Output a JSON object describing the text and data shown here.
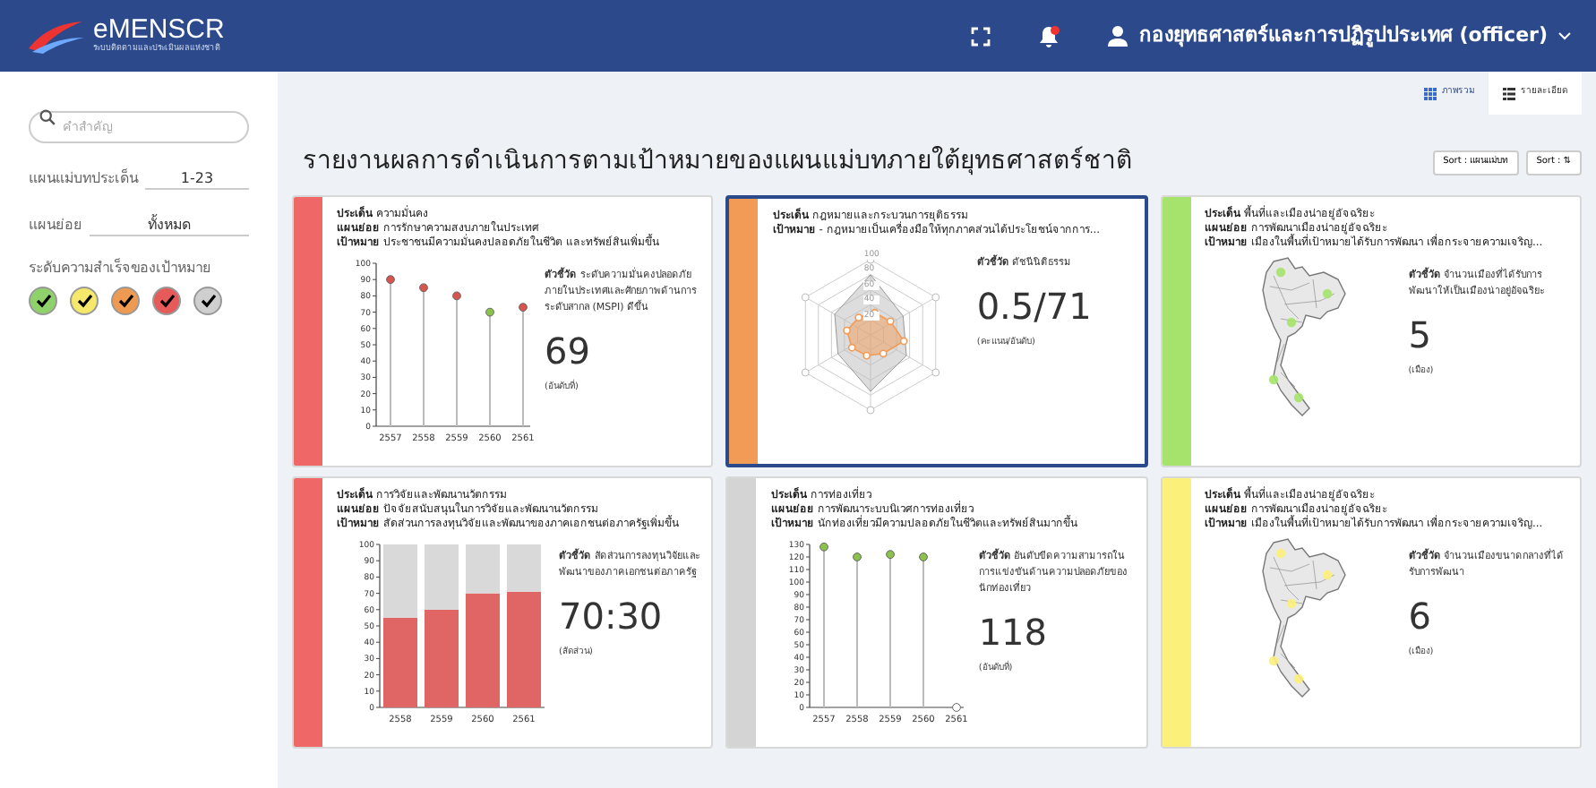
{
  "header": {
    "logo_text": "eMENSCR",
    "logo_subtitle": "ระบบติดตามและประเมินผลแห่งชาติ",
    "user_name": "กองยุทธศาสตร์และการปฏิรูปประเทศ (officer)"
  },
  "sidebar": {
    "search": {
      "placeholder": "คำสำคัญ"
    },
    "filters": [
      {
        "label": "แผนแม่บทประเด็น",
        "value": "1-23"
      },
      {
        "label": "แผนย่อย",
        "value": "ทั้งหมด"
      }
    ],
    "levels_label": "ระดับความสำเร็จของเป้าหมาย",
    "levels": [
      {
        "color": "#8fd16a",
        "checked": true
      },
      {
        "color": "#f5e86a",
        "checked": true
      },
      {
        "color": "#ef9a52",
        "checked": true
      },
      {
        "color": "#e65a5a",
        "checked": true
      },
      {
        "color": "#cfcfcf",
        "checked": true
      }
    ]
  },
  "view_tabs": [
    {
      "label": "ภาพรวม",
      "selected": false,
      "kind": "grid"
    },
    {
      "label": "รายละเอียด",
      "selected": true,
      "kind": "list"
    }
  ],
  "title": "รายงานผลการดำเนินการตามเป้าหมายของแผนแม่บทภายใต้ยุทธศาสตร์ชาติ",
  "sort_buttons": [
    "Sort : แผนแม่บท",
    "Sort : ⇅"
  ],
  "cards": [
    {
      "kind": "lollipop",
      "color": "#f06767",
      "selected": false,
      "lines": [
        {
          "key": "ประเด็น",
          "text": "ความมั่นคง"
        },
        {
          "key": "แผนย่อย",
          "text": "การรักษาความสงบภายในประเทศ"
        },
        {
          "key": "เป้าหมาย",
          "text": "ประชาชนมีความมั่นคงปลอดภัยในชีวิต และทรัพย์สินเพิ่มขึ้น"
        }
      ],
      "indicator_label": "ตัวชี้วัด",
      "indicator": "ระดับความมั่นคงปลอดภัยภายในประเทศและศักยภาพด้านการระดับสากล (MSPI) ดีขึ้น",
      "value": "69",
      "unit": "(อันดับที่)",
      "chart_data": {
        "type": "scatter",
        "grid": true,
        "categories": [
          "2557",
          "2558",
          "2559",
          "2560",
          "2561"
        ],
        "series": [
          {
            "color": "#d9534f",
            "values": [
              90,
              85,
              80,
              null,
              73
            ]
          },
          {
            "color": "#8bc34a",
            "values": [
              null,
              null,
              null,
              70,
              null
            ]
          }
        ],
        "ylim": [
          0,
          100
        ],
        "yticks": [
          0,
          10,
          20,
          30,
          40,
          50,
          60,
          70,
          80,
          90,
          100
        ]
      }
    },
    {
      "kind": "radar",
      "color": "#f29b57",
      "selected": true,
      "lines": [
        {
          "key": "ประเด็น",
          "text": "กฎหมายและกระบวนการยุติธรรม"
        },
        {
          "key": "เป้าหมาย",
          "text": "- กฎหมายเป็นเครื่องมือให้ทุกภาคส่วนได้ประโยชน์จากการ..."
        }
      ],
      "indicator_label": "ตัวชี้วัด",
      "indicator": "ดัชนีนิติธรรม",
      "value": "0.5/71",
      "unit": "(คะแนน/อันดับ)",
      "radar_ticks": [
        "100",
        "80",
        "60",
        "40",
        "20"
      ]
    },
    {
      "kind": "map",
      "color": "#a6e36c",
      "selected": false,
      "lines": [
        {
          "key": "ประเด็น",
          "text": "พื้นที่และเมืองน่าอยู่อัจฉริยะ"
        },
        {
          "key": "แผนย่อย",
          "text": "การพัฒนาเมืองน่าอยู่อัจฉริยะ"
        },
        {
          "key": "เป้าหมาย",
          "text": "เมืองในพื้นที่เป้าหมายได้รับการพัฒนา เพื่อกระจายความเจริญ..."
        }
      ],
      "indicator_label": "ตัวชี้วัด",
      "indicator": "จำนวนเมืองที่ได้รับการพัฒนาให้เป็นเมืองน่าอยู่อัจฉริยะ",
      "value": "5",
      "unit": "(เมือง)"
    },
    {
      "kind": "stacked_bar",
      "color": "#f06767",
      "selected": false,
      "lines": [
        {
          "key": "ประเด็น",
          "text": "การวิจัยและพัฒนานวัตกรรม"
        },
        {
          "key": "แผนย่อย",
          "text": "ปัจจัยสนับสนุนในการวิจัยและพัฒนานวัตกรรม"
        },
        {
          "key": "เป้าหมาย",
          "text": "สัดส่วนการลงทุนวิจัยและพัฒนาของภาคเอกชนต่อภาครัฐเพิ่มขึ้น"
        }
      ],
      "indicator_label": "ตัวชี้วัด",
      "indicator": "สัดส่วนการลงทุนวิจัยและพัฒนาของภาคเอกชนต่อภาครัฐ",
      "value": "70:30",
      "unit": "(สัดส่วน)",
      "chart_data": {
        "type": "bar",
        "stacked": true,
        "categories": [
          "2558",
          "2559",
          "2560",
          "2561"
        ],
        "series": [
          {
            "color": "#e06666",
            "values": [
              55,
              60,
              70,
              71
            ]
          },
          {
            "color": "#d9d9d9",
            "values": [
              45,
              40,
              30,
              29
            ]
          }
        ],
        "ylim": [
          0,
          100
        ],
        "yticks": [
          0,
          10,
          20,
          30,
          40,
          50,
          60,
          70,
          80,
          90,
          100
        ]
      }
    },
    {
      "kind": "lollipop",
      "color": "#d4d4d4",
      "selected": false,
      "lines": [
        {
          "key": "ประเด็น",
          "text": "การท่องเที่ยว"
        },
        {
          "key": "แผนย่อย",
          "text": "การพัฒนาระบบนิเวศการท่องเที่ยว"
        },
        {
          "key": "เป้าหมาย",
          "text": "นักท่องเที่ยวมีความปลอดภัยในชีวิตและทรัพย์สินมากขึ้น"
        }
      ],
      "indicator_label": "ตัวชี้วัด",
      "indicator": "อันดับขีดความสามารถในการแข่งขันด้านความปลอดภัยของนักท่องเที่ยว",
      "value": "118",
      "unit": "(อันดับที่)",
      "chart_data": {
        "type": "scatter",
        "grid": true,
        "categories": [
          "2557",
          "2558",
          "2559",
          "2560",
          "2561"
        ],
        "series": [
          {
            "color": "#8bc34a",
            "values": [
              128,
              120,
              122,
              120,
              null
            ]
          },
          {
            "color": "#ffffff",
            "values": [
              null,
              null,
              null,
              null,
              0
            ]
          }
        ],
        "ylim": [
          0,
          130
        ],
        "yticks": [
          0,
          10,
          20,
          30,
          40,
          50,
          60,
          70,
          80,
          90,
          100,
          110,
          120,
          130
        ]
      }
    },
    {
      "kind": "map",
      "color": "#fbf07a",
      "selected": false,
      "lines": [
        {
          "key": "ประเด็น",
          "text": "พื้นที่และเมืองน่าอยู่อัจฉริยะ"
        },
        {
          "key": "แผนย่อย",
          "text": "การพัฒนาเมืองน่าอยู่อัจฉริยะ"
        },
        {
          "key": "เป้าหมาย",
          "text": "เมืองในพื้นที่เป้าหมายได้รับการพัฒนา เพื่อกระจายความเจริญ..."
        }
      ],
      "indicator_label": "ตัวชี้วัด",
      "indicator": "จำนวนเมืองขนาดกลางที่ได้รับการพัฒนา",
      "value": "6",
      "unit": "(เมือง)"
    }
  ]
}
